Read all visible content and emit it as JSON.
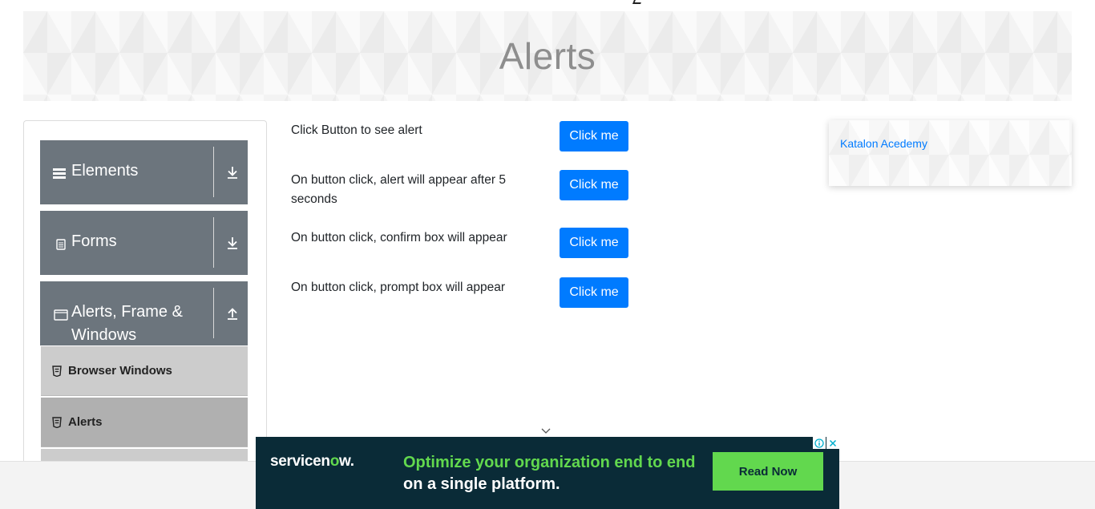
{
  "banner": {
    "title": "Alerts"
  },
  "sidebar": {
    "groups": [
      {
        "label": "Elements",
        "icon": "hamburger-icon",
        "arrow": "download-arrow-icon"
      },
      {
        "label": "Forms",
        "icon": "document-icon",
        "arrow": "download-arrow-icon"
      },
      {
        "label": "Alerts, Frame & Windows",
        "label_line1": "Alerts, Frame &",
        "label_line2": "Windows",
        "icon": "window-icon",
        "arrow": "upload-arrow-icon"
      }
    ],
    "items": [
      {
        "label": "Browser Windows",
        "icon": "html5-icon",
        "bg": "#cccccc"
      },
      {
        "label": "Alerts",
        "icon": "html5-icon",
        "bg": "#b0b0b0"
      }
    ]
  },
  "alerts": [
    {
      "text": "Click Button to see alert",
      "button": "Click me"
    },
    {
      "text": "On button click, alert will appear after 5 seconds",
      "button": "Click me"
    },
    {
      "text": "On button click, confirm box will appear",
      "button": "Click me"
    },
    {
      "text": "On button click, prompt box will appear",
      "button": "Click me"
    }
  ],
  "right_card": {
    "link": "Katalon Acedemy"
  },
  "ad": {
    "logo_prefix": "servicen",
    "logo_dot": "o",
    "logo_suffix": "w.",
    "headline_green": "Optimize your organization end to end",
    "headline_white": " on a single platform.",
    "cta": "Read Now",
    "choices_icon": "ad-choices-icon",
    "close_icon": "close-icon"
  },
  "colors": {
    "primary": "#007bff",
    "sidebar_group": "#6c757d",
    "ad_bg": "#0a2b37",
    "ad_accent": "#62d84e"
  }
}
